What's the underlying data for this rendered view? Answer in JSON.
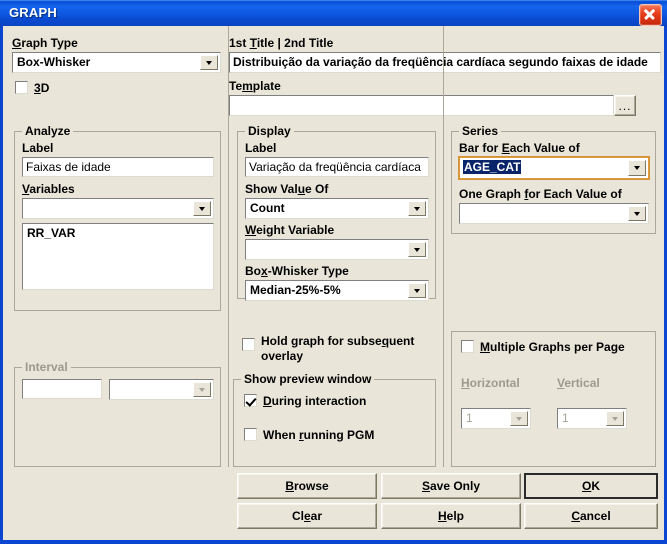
{
  "window": {
    "title": "GRAPH",
    "close_icon": "close-icon"
  },
  "graph_type": {
    "label": "Graph Type",
    "value": "Box-Whisker",
    "threed_label": "3D",
    "threed_checked": false
  },
  "titles": {
    "label": "1st Title | 2nd Title",
    "value": "Distribuição da variação da freqüência cardíaca segundo faixas de idade",
    "template_label": "Template",
    "template_value": "",
    "template_browse_label": "..."
  },
  "analyze": {
    "group_title": "Analyze",
    "label_caption": "Label",
    "label_value": "Faixas de idade",
    "variables_caption": "Variables",
    "variables_value": "",
    "variables_list": [
      "RR_VAR"
    ]
  },
  "display": {
    "group_title": "Display",
    "label_caption": "Label",
    "label_value": "Variação da freqüência cardíaca",
    "show_value_of_caption": "Show Value Of",
    "show_value_of_value": "Count",
    "weight_variable_caption": "Weight Variable",
    "weight_variable_value": "",
    "box_whisker_type_caption": "Box-Whisker Type",
    "box_whisker_type_value": "Median-25%-5%"
  },
  "series": {
    "group_title": "Series",
    "bar_for_each_caption": "Bar for Each Value of",
    "bar_for_each_value": "AGE_CAT",
    "one_graph_caption": "One Graph for Each Value of",
    "one_graph_value": ""
  },
  "interval": {
    "group_title": "Interval",
    "value_1": "",
    "value_2": "",
    "disabled": true
  },
  "hold_graph": {
    "line1": "Hold graph for subsequent",
    "line2": "overlay",
    "checked": false
  },
  "preview": {
    "group_title": "Show preview window",
    "during_interaction_label": "During interaction",
    "during_interaction_checked": true,
    "when_running_label": "When running PGM",
    "when_running_checked": false
  },
  "multiple_graphs": {
    "title": "Multiple Graphs per Page",
    "checked": false,
    "horizontal_label": "Horizontal",
    "horizontal_value": "1",
    "vertical_label": "Vertical",
    "vertical_value": "1",
    "disabled": true
  },
  "buttons": {
    "browse": "Browse",
    "clear": "Clear",
    "save_only": "Save Only",
    "help": "Help",
    "ok": "OK",
    "cancel": "Cancel"
  },
  "colors": {
    "dialog_face": "#E9E6D9",
    "titlebar_blue": "#0A4FD6",
    "selection_blue": "#0A246A",
    "close_red": "#C42708",
    "disabled_text": "#9C9A8E"
  }
}
